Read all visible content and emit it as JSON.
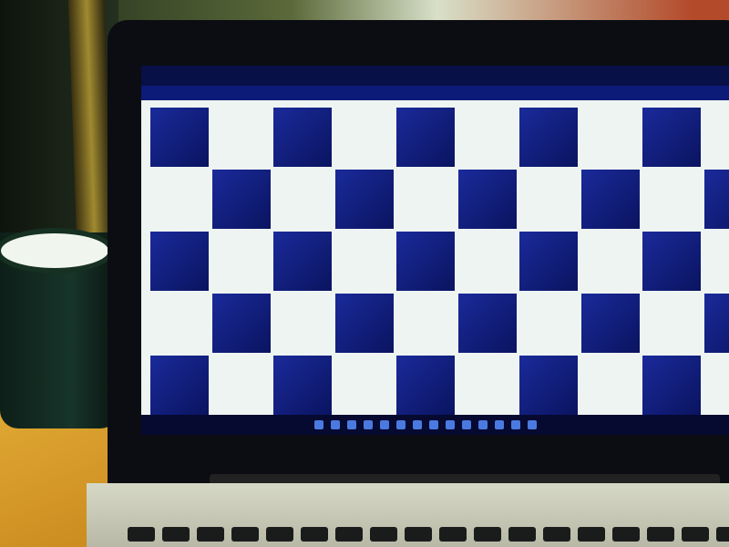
{
  "scene": {
    "subject": "laptop-displaying-checkerboard",
    "checkerboard": {
      "rows": 5,
      "cols": 10,
      "dark_color": "#0f1a78",
      "light_color": "#eef4f2"
    },
    "taskbar_icon_count": 14,
    "keyboard_key_count": 18
  },
  "colors": {
    "bezel": "#0b0d12",
    "desk": "#c9a23a",
    "mug": "#17352a"
  }
}
